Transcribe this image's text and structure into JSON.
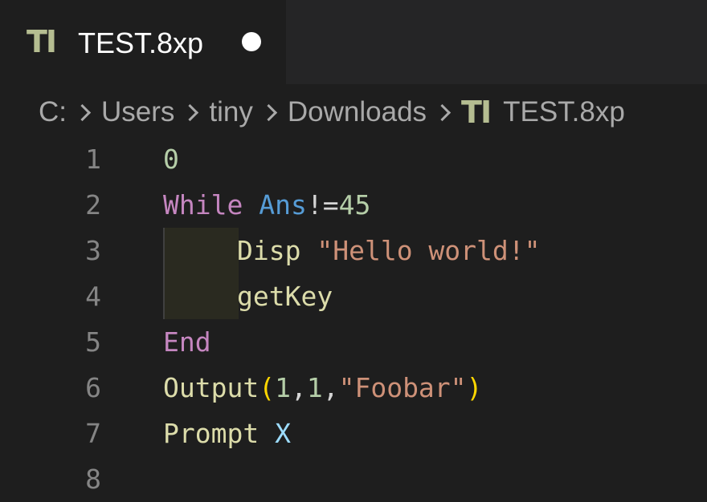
{
  "tab": {
    "icon": "TI",
    "icon_name": "ti-file-icon",
    "title": "TEST.8xp",
    "dirty_indicator": "unsaved-dot-icon"
  },
  "breadcrumb": {
    "items": [
      "C:",
      "Users",
      "tiny",
      "Downloads"
    ],
    "file_icon": "TI",
    "file_name": "TEST.8xp"
  },
  "editor": {
    "lines": [
      {
        "number": "1",
        "tokens": [
          {
            "t": "0",
            "c": "num"
          }
        ]
      },
      {
        "number": "2",
        "tokens": [
          {
            "t": "While",
            "c": "kw"
          },
          {
            "t": " ",
            "c": "op"
          },
          {
            "t": "Ans",
            "c": "var"
          },
          {
            "t": "!=",
            "c": "op"
          },
          {
            "t": "45",
            "c": "num"
          }
        ]
      },
      {
        "number": "3",
        "indent": true,
        "tokens": [
          {
            "t": "Disp",
            "c": "fn"
          },
          {
            "t": " ",
            "c": "op"
          },
          {
            "t": "\"Hello world!\"",
            "c": "str"
          }
        ]
      },
      {
        "number": "4",
        "indent": true,
        "tokens": [
          {
            "t": "getKey",
            "c": "fn"
          }
        ]
      },
      {
        "number": "5",
        "tokens": [
          {
            "t": "End",
            "c": "kw"
          }
        ]
      },
      {
        "number": "6",
        "tokens": [
          {
            "t": "Output",
            "c": "fn"
          },
          {
            "t": "(",
            "c": "paren"
          },
          {
            "t": "1",
            "c": "num"
          },
          {
            "t": ",",
            "c": "op"
          },
          {
            "t": "1",
            "c": "num"
          },
          {
            "t": ",",
            "c": "op"
          },
          {
            "t": "\"Foobar\"",
            "c": "str"
          },
          {
            "t": ")",
            "c": "paren"
          }
        ]
      },
      {
        "number": "7",
        "tokens": [
          {
            "t": "Prompt",
            "c": "fn"
          },
          {
            "t": " ",
            "c": "op"
          },
          {
            "t": "X",
            "c": "id"
          }
        ]
      },
      {
        "number": "8",
        "tokens": []
      }
    ]
  },
  "colors": {
    "background": "#1e1e1e",
    "tabbar": "#252526",
    "keyword": "#c586c0",
    "variable": "#569cd6",
    "number": "#b5cea8",
    "function": "#dcdcaa",
    "string": "#ce9178",
    "bracket": "#ffd700",
    "identifier": "#9cdcfe",
    "line_number": "#858585"
  }
}
